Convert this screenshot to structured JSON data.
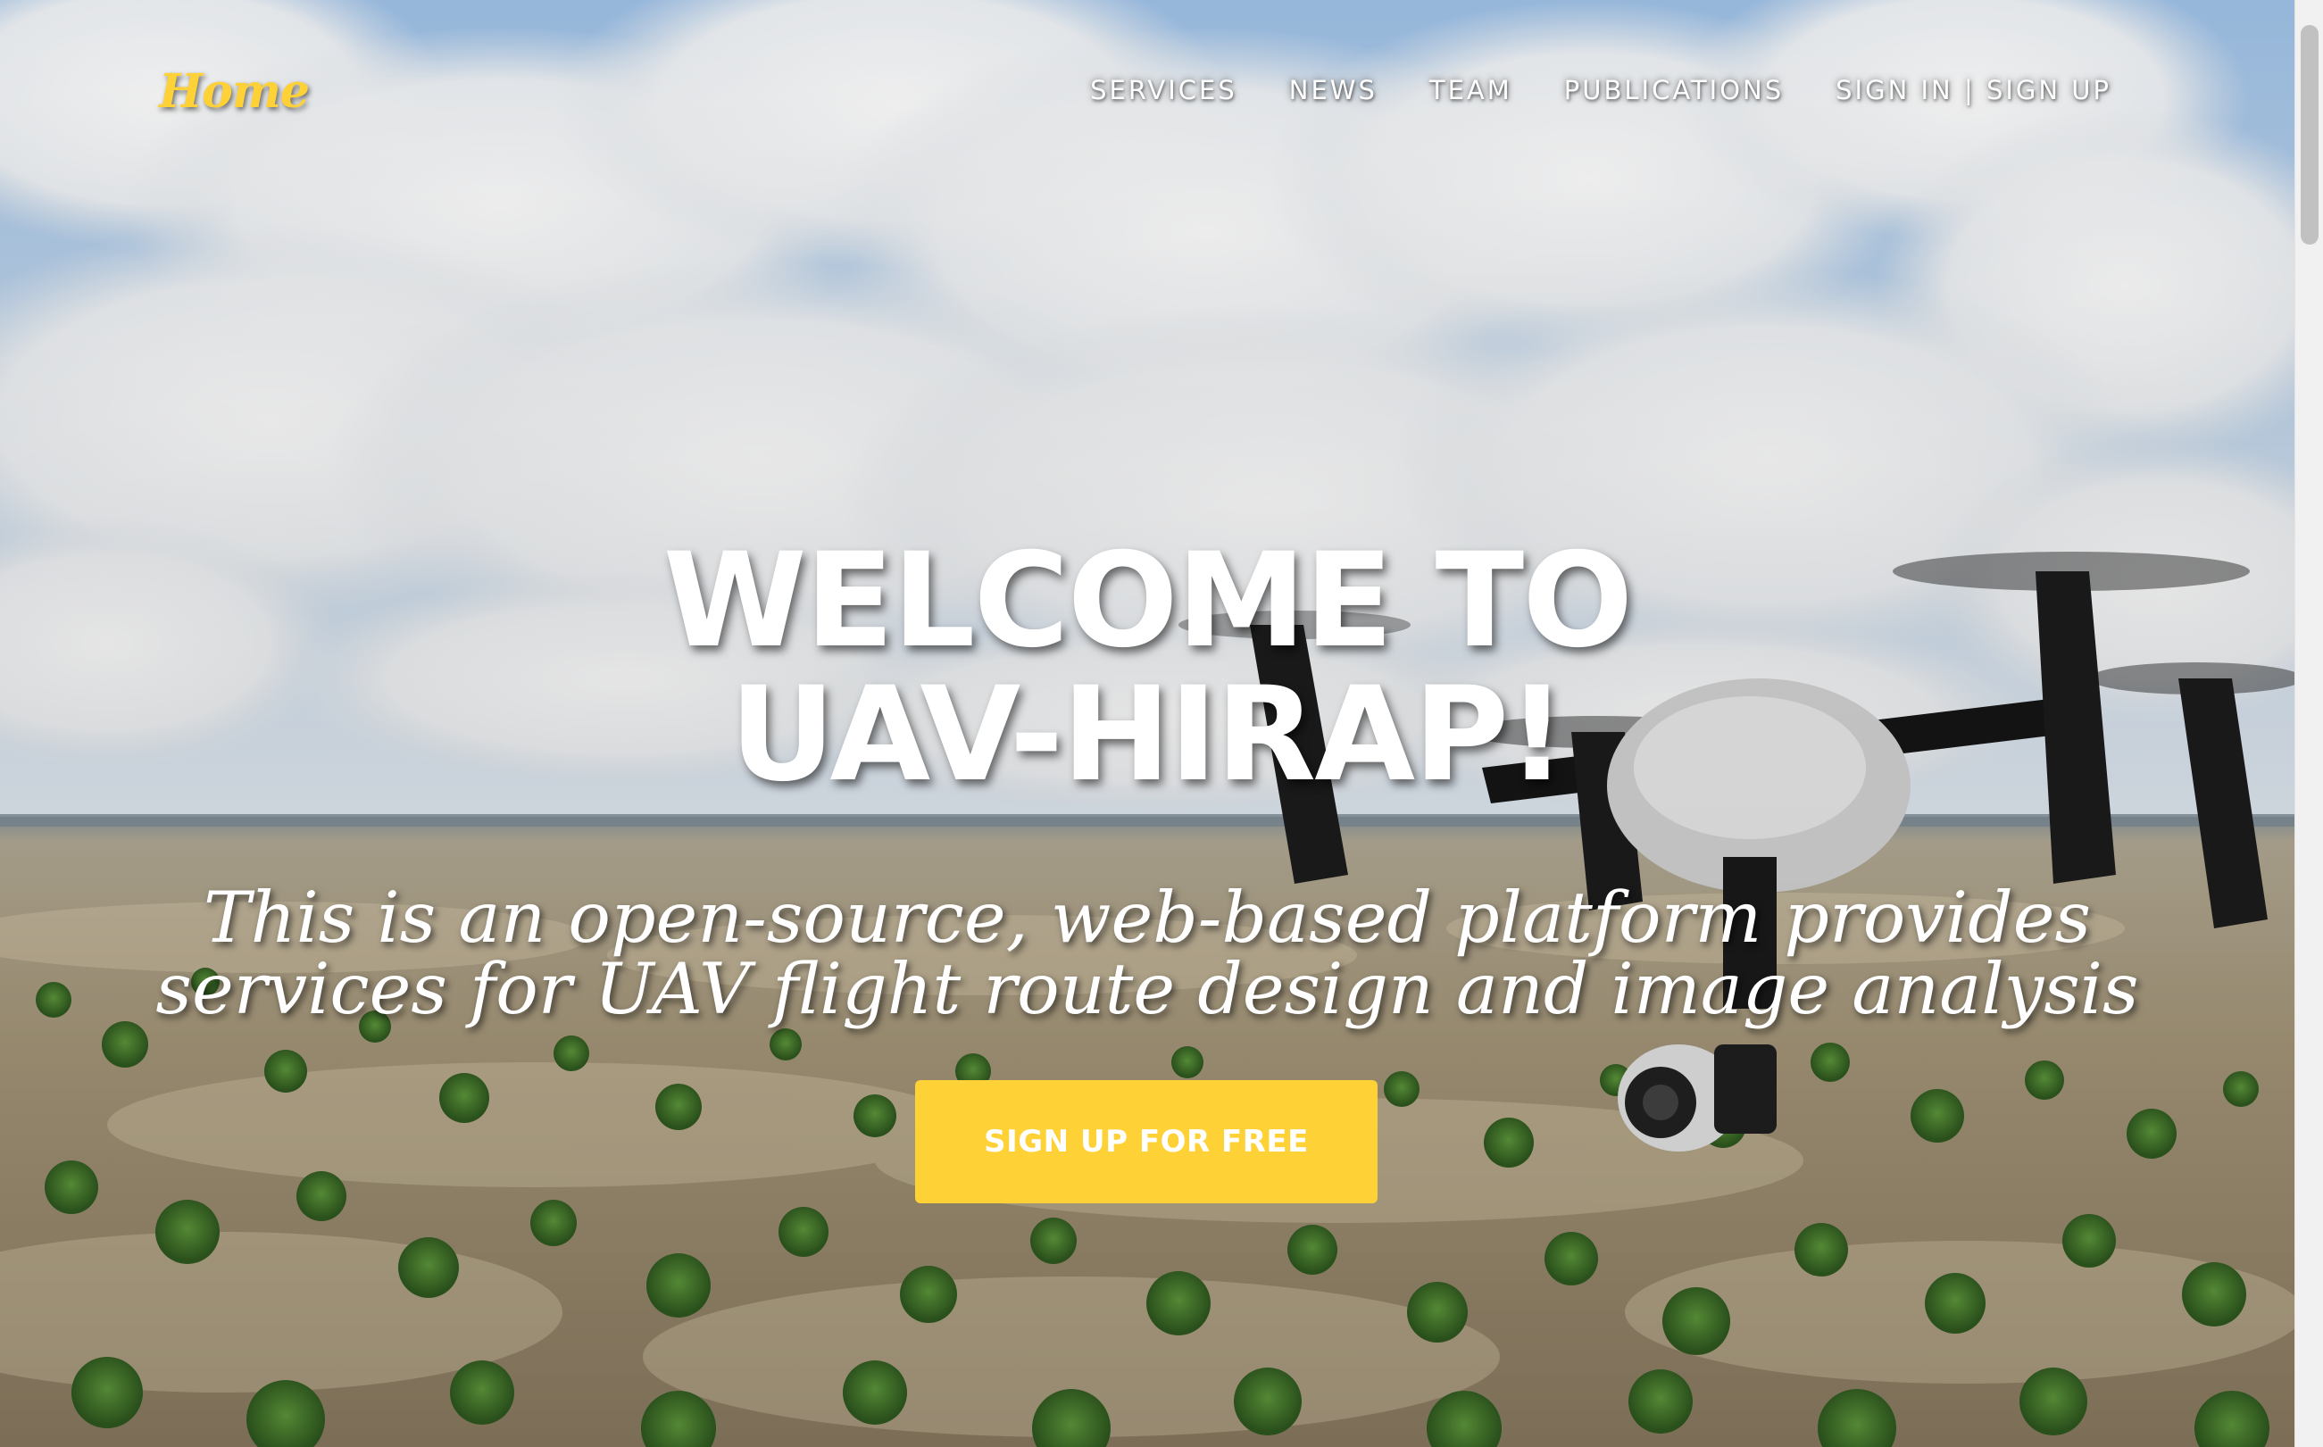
{
  "nav": {
    "brand": "Home",
    "links": [
      "SERVICES",
      "NEWS",
      "TEAM",
      "PUBLICATIONS",
      "SIGN IN | SIGN UP"
    ]
  },
  "hero": {
    "heading_lines": [
      "WELCOME TO",
      "UAV-HIRAP!"
    ],
    "subheading_lines": [
      "This is an open-source, web-based platform provides",
      "services for UAV flight route design and image analysis"
    ],
    "cta_label": "SIGN UP FOR FREE",
    "background": "aerial photo of a drone flying over green savanna under cloudy sky"
  },
  "colors": {
    "accent": "#fed136",
    "text": "#ffffff"
  }
}
